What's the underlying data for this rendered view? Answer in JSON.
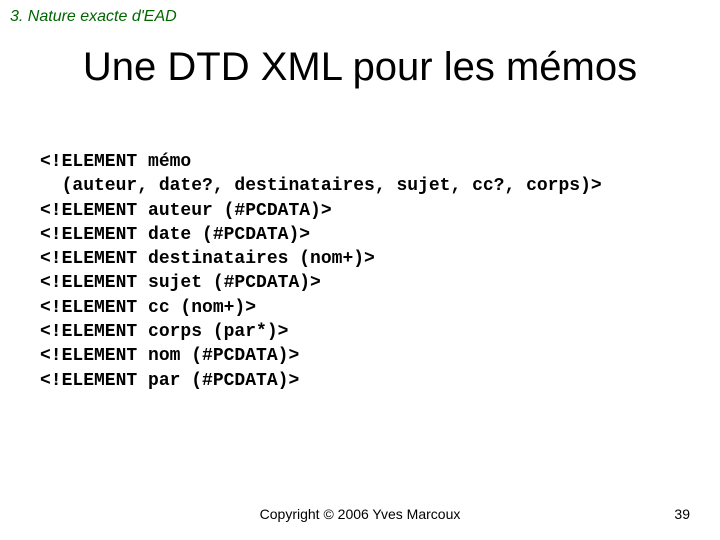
{
  "header": {
    "section": "3. Nature exacte d'EAD"
  },
  "title": "Une DTD XML pour les mémos",
  "code": {
    "lines": [
      "<!ELEMENT mémo",
      "  (auteur, date?, destinataires, sujet, cc?, corps)>",
      "<!ELEMENT auteur (#PCDATA)>",
      "<!ELEMENT date (#PCDATA)>",
      "<!ELEMENT destinataires (nom+)>",
      "<!ELEMENT sujet (#PCDATA)>",
      "<!ELEMENT cc (nom+)>",
      "<!ELEMENT corps (par*)>",
      "<!ELEMENT nom (#PCDATA)>",
      "<!ELEMENT par (#PCDATA)>"
    ]
  },
  "footer": {
    "copyright": "Copyright © 2006 Yves Marcoux",
    "page": "39"
  }
}
